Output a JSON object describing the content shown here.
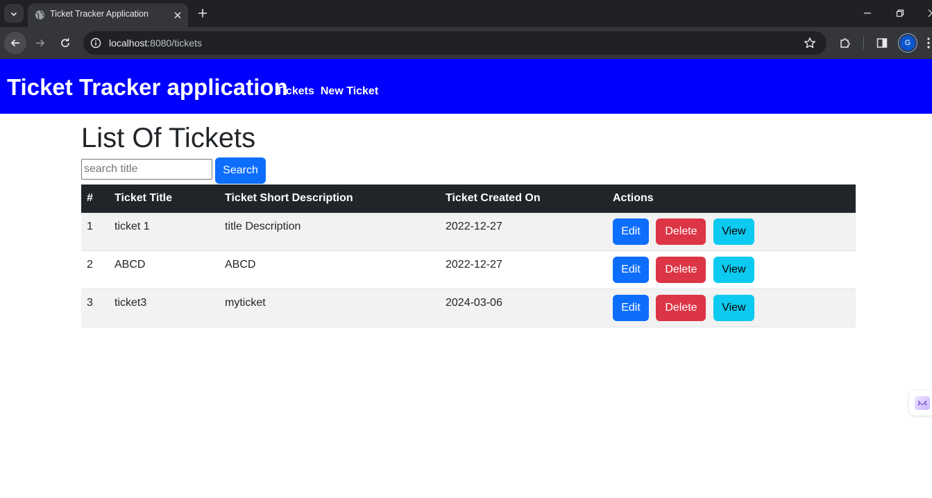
{
  "browser": {
    "tab_title": "Ticket Tracker Application",
    "url_host": "localhost:",
    "url_path": "8080/tickets",
    "profile_initial": "G",
    "icons": {
      "tab_search": "chevron-down-icon",
      "favicon": "globe-icon",
      "tab_close": "close-icon",
      "new_tab": "plus-icon",
      "minimize": "minimize-icon",
      "restore": "restore-icon",
      "close_window": "close-icon",
      "back": "arrow-left-icon",
      "forward": "arrow-right-icon",
      "reload": "reload-icon",
      "site_info": "info-icon",
      "bookmark": "star-icon",
      "extensions": "puzzle-icon",
      "side_panel": "side-panel-icon",
      "menu": "menu-dots-icon"
    }
  },
  "navbar": {
    "brand": "Ticket Tracker application",
    "links": [
      {
        "label": "Tickets"
      },
      {
        "label": "New Ticket"
      }
    ],
    "background_color": "#0000ff"
  },
  "main": {
    "heading": "List Of Tickets",
    "search": {
      "placeholder": "search title",
      "value": "",
      "button_label": "Search"
    },
    "table": {
      "headers": [
        "#",
        "Ticket Title",
        "Ticket Short Description",
        "Ticket Created On",
        "Actions"
      ],
      "rows": [
        {
          "num": "1",
          "title": "ticket 1",
          "description": "title Description",
          "created_on": "2022-12-27"
        },
        {
          "num": "2",
          "title": "ABCD",
          "description": "ABCD",
          "created_on": "2022-12-27"
        },
        {
          "num": "3",
          "title": "ticket3",
          "description": "myticket",
          "created_on": "2024-03-06"
        }
      ],
      "actions": {
        "edit": "Edit",
        "delete": "Delete",
        "view": "View"
      }
    }
  },
  "colors": {
    "primary": "#0d6efd",
    "danger": "#dc3545",
    "info": "#0dcaf0",
    "table_header": "#212529"
  }
}
